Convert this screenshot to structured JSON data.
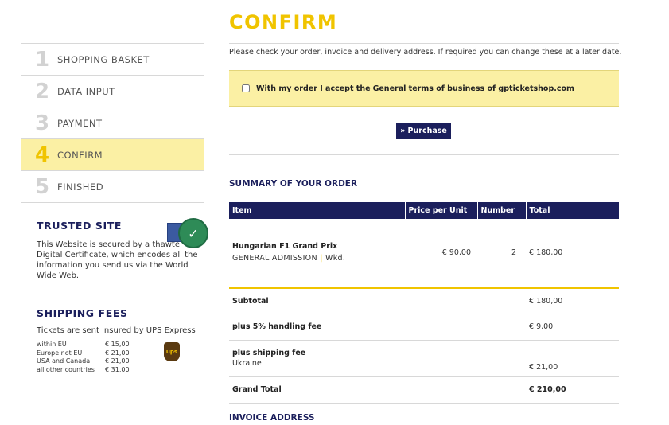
{
  "steps": [
    {
      "num": "1",
      "label": "SHOPPING BASKET"
    },
    {
      "num": "2",
      "label": "DATA INPUT"
    },
    {
      "num": "3",
      "label": "PAYMENT"
    },
    {
      "num": "4",
      "label": "CONFIRM"
    },
    {
      "num": "5",
      "label": "FINISHED"
    }
  ],
  "trusted": {
    "title": "TRUSTED SITE",
    "text": "This Website is secured by a thawte Digital Certificate, which encodes all the information you send us via the World Wide Web."
  },
  "shipping": {
    "title": "SHIPPING FEES",
    "text": "Tickets are sent insured by UPS Express",
    "ups_label": "ups",
    "fees": [
      {
        "region": "within EU",
        "price": "€ 15,00"
      },
      {
        "region": "Europe not EU",
        "price": "€ 21,00"
      },
      {
        "region": "USA and Canada",
        "price": "€ 21,00"
      },
      {
        "region": "all other countries",
        "price": "€ 31,00"
      }
    ]
  },
  "main": {
    "title": "CONFIRM",
    "intro": "Please check your order, invoice and delivery address. If required you can change these at a later date.",
    "accept_text": "With my order I accept the",
    "accept_link": "General terms of business of gpticketshop.com",
    "purchase_label": "» Purchase",
    "summary_title": "SUMMARY OF YOUR ORDER",
    "invoice_title": "INVOICE ADDRESS"
  },
  "table": {
    "headers": [
      "Item",
      "Price per Unit",
      "Number",
      "Total"
    ],
    "item": {
      "name": "Hungarian F1 Grand Prix",
      "category": "GENERAL ADMISSION",
      "sep": "|",
      "variant": "Wkd.",
      "price": "€ 90,00",
      "number": "2",
      "total": "€ 180,00"
    },
    "subtotal_label": "Subtotal",
    "subtotal": "€ 180,00",
    "handling_label": "plus 5% handling fee",
    "handling": "€ 9,00",
    "shipping_label": "plus shipping fee",
    "shipping_country": "Ukraine",
    "shipping": "€ 21,00",
    "grand_label": "Grand Total",
    "grand": "€ 210,00"
  },
  "colors": {
    "accent_yellow": "#f0c400",
    "navy": "#1b1f5c",
    "highlight": "#fbf0a4"
  }
}
